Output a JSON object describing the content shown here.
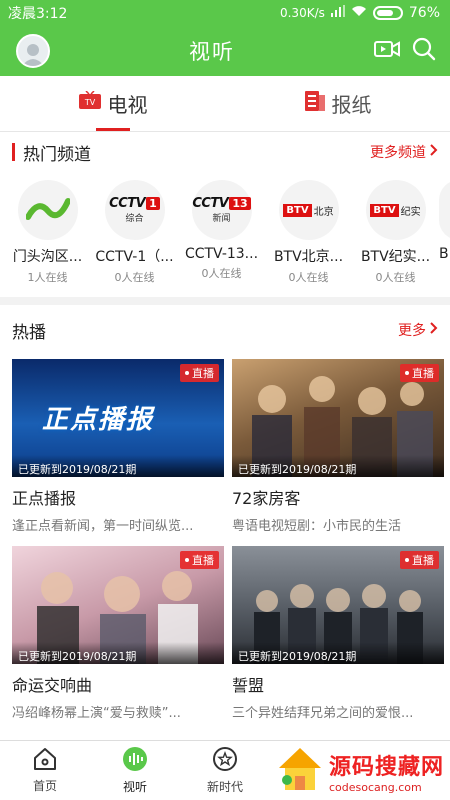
{
  "status": {
    "time": "凌晨3:12",
    "speed": "0.30K/s",
    "battery": "76%",
    "battery_level": 0.76
  },
  "header": {
    "title": "视听"
  },
  "tabs": [
    {
      "label": "电视",
      "active": true
    },
    {
      "label": "报纸",
      "active": false
    }
  ],
  "hot_channels": {
    "title": "热门频道",
    "more": "更多频道",
    "items": [
      {
        "name": "门头沟区...",
        "online": "1人在线",
        "logo": "mentougou"
      },
      {
        "name": "CCTV-1（...",
        "online": "0人在线",
        "logo": "cctv1",
        "logo_num": "1",
        "logo_sub": "综合"
      },
      {
        "name": "CCTV-13...",
        "online": "0人在线",
        "logo": "cctv13",
        "logo_num": "13",
        "logo_sub": "新闻"
      },
      {
        "name": "BTV北京...",
        "online": "0人在线",
        "logo": "btv-beijing",
        "logo_badge": "BTV",
        "logo_sub": "北京"
      },
      {
        "name": "BTV纪实...",
        "online": "0人在线",
        "logo": "btv-jishi",
        "logo_badge": "BTV",
        "logo_sub": "纪实"
      },
      {
        "name": "B",
        "online": "",
        "logo": "btv-partial"
      }
    ]
  },
  "hot_play": {
    "title": "热播",
    "more": "更多",
    "live_label": "直播",
    "items": [
      {
        "title": "正点播报",
        "desc": "逢正点看新闻，第一时间纵览...",
        "updated": "已更新到2019/08/21期",
        "thumb_text": "正点播报",
        "thumb_color": "#1a5fb4"
      },
      {
        "title": "72家房客",
        "desc": "粤语电视短剧：小市民的生活",
        "updated": "已更新到2019/08/21期",
        "thumb_text": "",
        "thumb_color": "#7a5a3a"
      },
      {
        "title": "命运交响曲",
        "desc": "冯绍峰杨幂上演“爱与救赎”...",
        "updated": "已更新到2019/08/21期",
        "thumb_text": "",
        "thumb_color": "#c89aa8"
      },
      {
        "title": "誓盟",
        "desc": "三个异姓结拜兄弟之间的爱恨...",
        "updated": "已更新到2019/08/21期",
        "thumb_text": "",
        "thumb_color": "#5a6068"
      }
    ]
  },
  "bottom_nav": [
    {
      "label": "首页",
      "icon": "home-icon",
      "active": false
    },
    {
      "label": "视听",
      "icon": "audio-wave-icon",
      "active": true
    },
    {
      "label": "新时代",
      "icon": "star-icon",
      "active": false
    }
  ],
  "watermark": {
    "big": "源码搜藏网",
    "small": "codesocang.com"
  },
  "colors": {
    "brand_green": "#5ac84a",
    "accent_red": "#e02020"
  }
}
